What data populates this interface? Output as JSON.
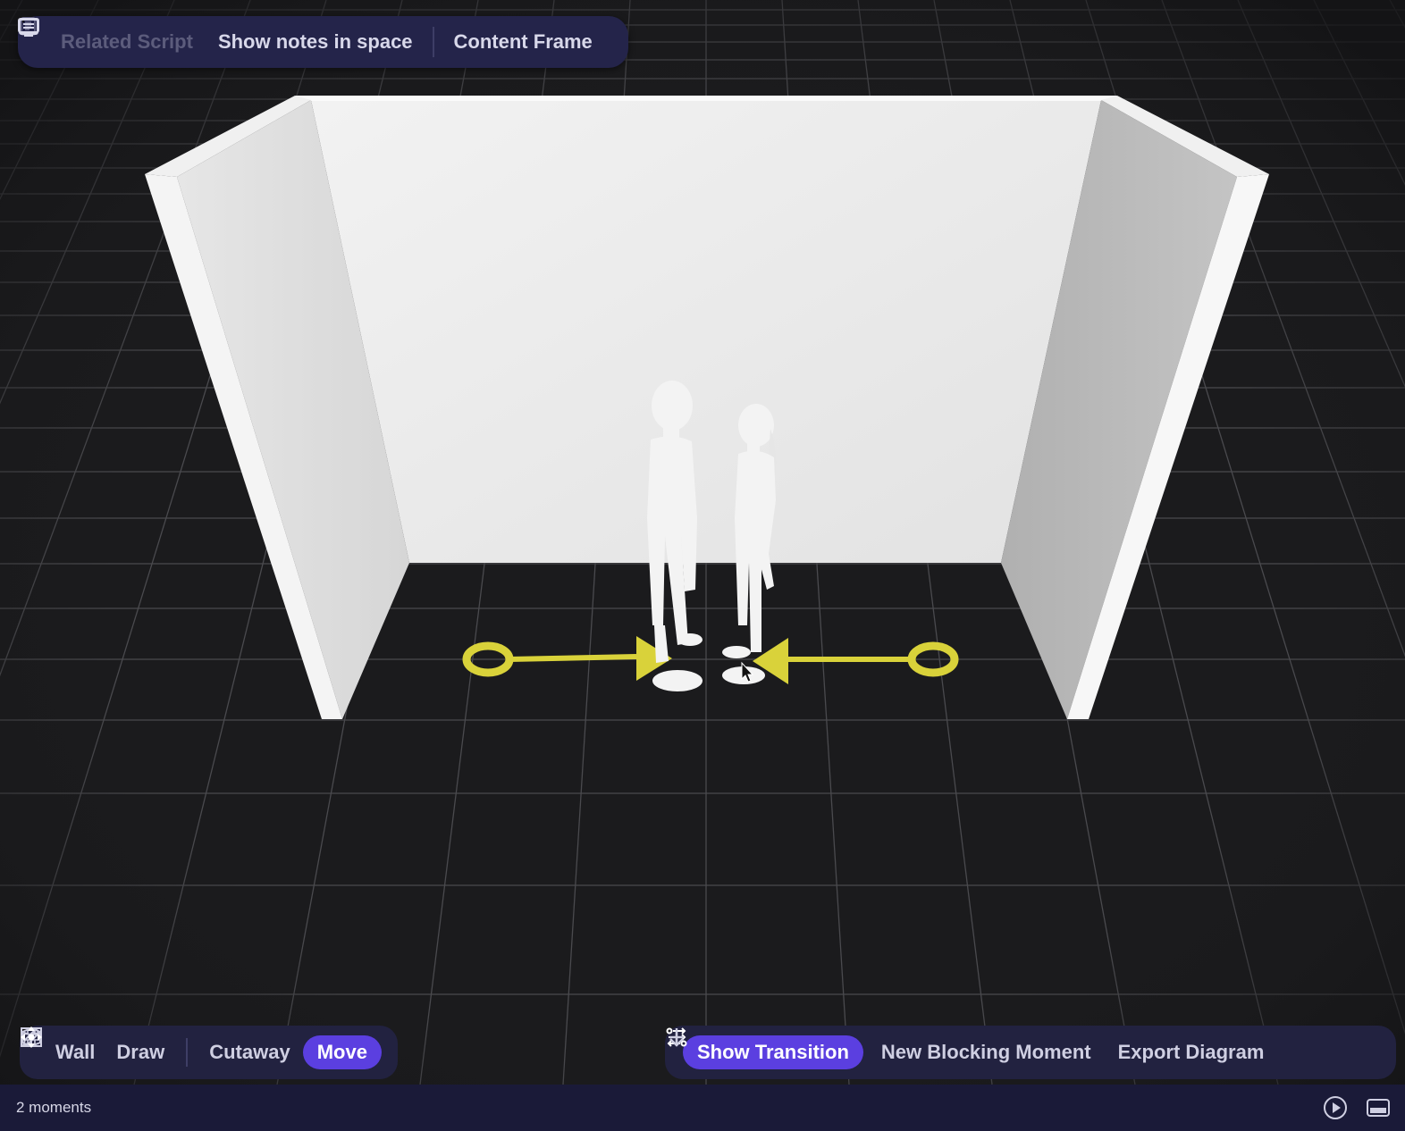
{
  "toolbar_top": {
    "related_script": "Related Script",
    "show_notes": "Show notes in space",
    "content_frame": "Content Frame"
  },
  "toolbar_bottom_left": {
    "wall": "Wall",
    "draw": "Draw",
    "cutaway": "Cutaway",
    "move": "Move",
    "active_tool": "Move"
  },
  "toolbar_bottom_right": {
    "show_transition": "Show Transition",
    "new_blocking_moment": "New Blocking Moment",
    "export_diagram": "Export Diagram"
  },
  "status": {
    "moments": "2 moments"
  },
  "colors": {
    "accent": "#5b3fe0",
    "marker": "#d9d23a",
    "floor": "#1b1b1d",
    "toolbar": "#24244a"
  },
  "icons": [
    "script-icon",
    "notes-icon",
    "monitor-icon",
    "wall-icon",
    "pencil-icon",
    "cutaway-icon",
    "move-icon",
    "transition-icon",
    "plus-icon",
    "download-icon",
    "play-icon",
    "panel-icon"
  ]
}
